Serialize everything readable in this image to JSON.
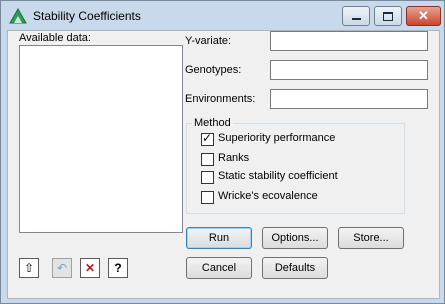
{
  "window": {
    "title": "Stability Coefficients"
  },
  "caption_buttons": {
    "minimize": "▭",
    "maximize": "▢",
    "close": "✕"
  },
  "left": {
    "available_data_label": "Available data:"
  },
  "fields": [
    {
      "label": "Y-variate:",
      "value": ""
    },
    {
      "label": "Genotypes:",
      "value": ""
    },
    {
      "label": "Environments:",
      "value": ""
    }
  ],
  "method": {
    "title": "Method",
    "options": [
      {
        "label": "Superiority performance",
        "checked": true
      },
      {
        "label": "Ranks",
        "checked": false
      },
      {
        "label": "Static stability coefficient",
        "checked": false
      },
      {
        "label": "Wricke's ecovalence",
        "checked": false
      }
    ]
  },
  "buttons": {
    "run": "Run",
    "options": "Options...",
    "store": "Store...",
    "cancel": "Cancel",
    "defaults": "Defaults"
  },
  "toolbar": {
    "transfer_icon": "⇧",
    "undo_icon": "↶",
    "clear_icon": "✕",
    "help_icon": "?"
  }
}
